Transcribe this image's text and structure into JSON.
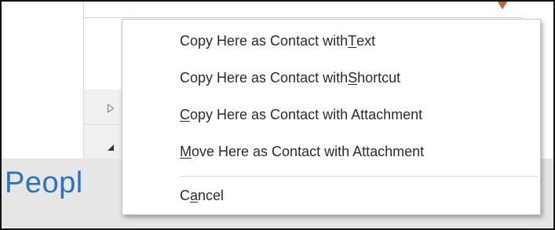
{
  "background": {
    "module_label": "Peopl",
    "accent_color": "#2b73c0",
    "marker_color": "#c06a2a",
    "icons": [
      "expand-right-icon",
      "collapse-down-icon"
    ]
  },
  "context_menu": {
    "items": [
      {
        "pre": "Copy Here as Contact with ",
        "key": "T",
        "post": "ext"
      },
      {
        "pre": "Copy Here as Contact with ",
        "key": "S",
        "post": "hortcut"
      },
      {
        "pre": "",
        "key": "C",
        "post": "opy Here as Contact with Attachment"
      },
      {
        "pre": "",
        "key": "M",
        "post": "ove Here as Contact with Attachment"
      }
    ],
    "cancel": {
      "pre": "C",
      "key": "a",
      "post": "ncel"
    }
  }
}
